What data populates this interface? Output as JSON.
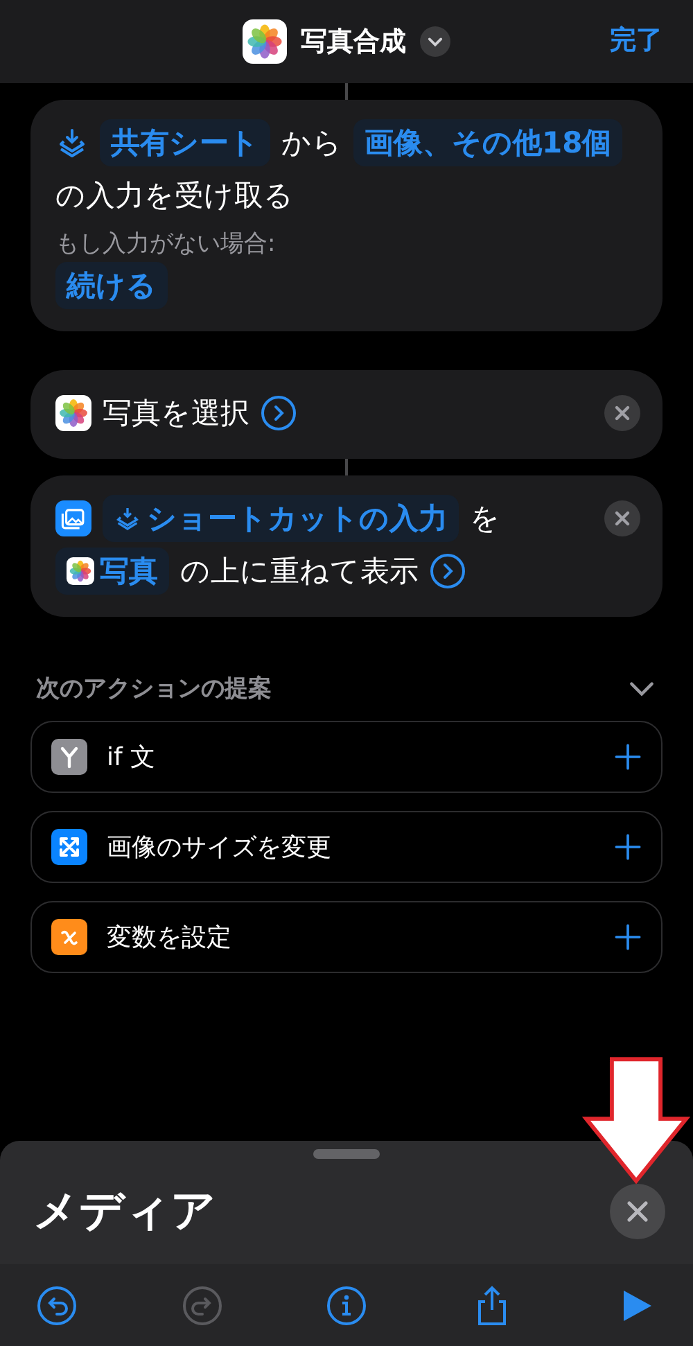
{
  "header": {
    "title": "写真合成",
    "done": "完了"
  },
  "actions": [
    {
      "kind": "receive",
      "deletable": false,
      "expandable": false,
      "line": [
        {
          "kind": "share-token",
          "text": "共有シート"
        },
        {
          "kind": "plain",
          "text": "から"
        },
        {
          "kind": "token",
          "text": "画像、その他18個"
        },
        {
          "kind": "plain",
          "text": "の入力を受け取る"
        }
      ],
      "fallback_label": "もし入力がない場合:",
      "fallback": "続ける"
    },
    {
      "kind": "select",
      "deletable": true,
      "expandable": true,
      "line": [
        {
          "kind": "plain",
          "text": "写真を選択"
        }
      ]
    },
    {
      "kind": "overlay",
      "deletable": true,
      "expandable": true,
      "line": [
        {
          "kind": "input-token",
          "text": "ショートカットの入力"
        },
        {
          "kind": "plain",
          "text": "を"
        },
        {
          "kind": "photos-token",
          "text": "写真"
        },
        {
          "kind": "plain",
          "text": "の上に重ねて表示"
        }
      ]
    }
  ],
  "suggestions": {
    "title": "次のアクションの提案",
    "expanded": true,
    "items": [
      {
        "kind": "if",
        "label": "if 文",
        "color": "#8e8e93"
      },
      {
        "kind": "resize",
        "label": "画像のサイズを変更",
        "color": "#0a84ff"
      },
      {
        "kind": "variable",
        "label": "変数を設定",
        "color": "#ff8c1a"
      }
    ]
  },
  "sheet": {
    "title": "メディア"
  },
  "toolbar": [
    {
      "kind": "undo",
      "disabled": false
    },
    {
      "kind": "redo",
      "disabled": true
    },
    {
      "kind": "info",
      "disabled": false
    },
    {
      "kind": "share",
      "disabled": false
    },
    {
      "kind": "run",
      "disabled": false
    }
  ]
}
